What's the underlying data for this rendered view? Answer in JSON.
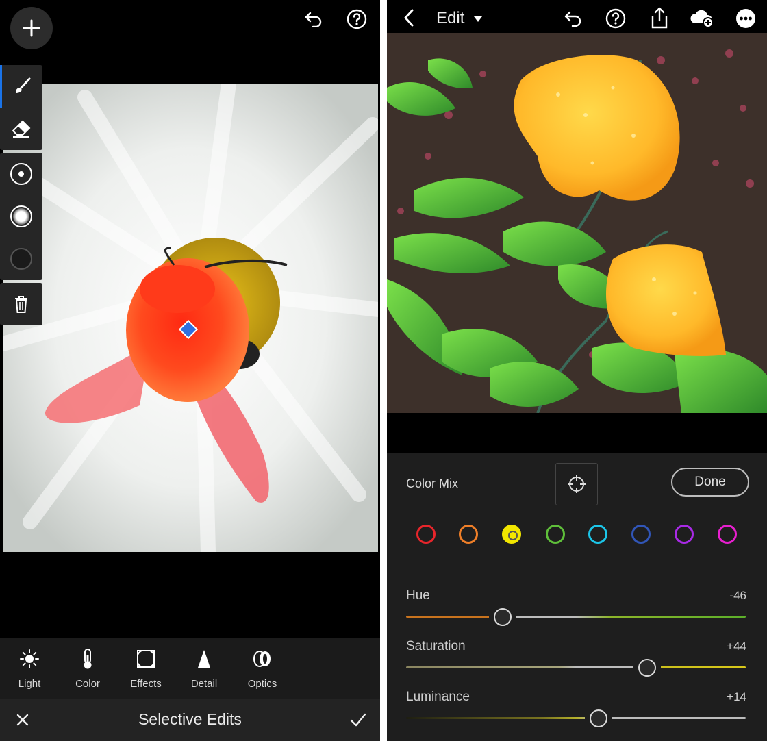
{
  "left_panel": {
    "bottom_toolbar": [
      {
        "label": "Light",
        "icon": "sun-icon"
      },
      {
        "label": "Color",
        "icon": "thermometer-icon"
      },
      {
        "label": "Effects",
        "icon": "vignette-frame-icon"
      },
      {
        "label": "Detail",
        "icon": "triangle-icon"
      },
      {
        "label": "Optics",
        "icon": "lens-icon"
      }
    ],
    "footer": {
      "title": "Selective Edits"
    }
  },
  "right_panel": {
    "header": {
      "title": "Edit"
    },
    "color_mix": {
      "label": "Color Mix",
      "done_label": "Done",
      "swatches": [
        "#e8252b",
        "#f07f28",
        "#f2e600",
        "#5fbf3a",
        "#1cc5e8",
        "#3156b8",
        "#a92ae6",
        "#e81fcf"
      ],
      "selected_swatch": "yellow",
      "sliders": [
        {
          "name": "Hue",
          "value": "-46",
          "fraction": 0.285
        },
        {
          "name": "Saturation",
          "value": "+44",
          "fraction": 0.71
        },
        {
          "name": "Luminance",
          "value": "+14",
          "fraction": 0.567
        }
      ]
    }
  }
}
